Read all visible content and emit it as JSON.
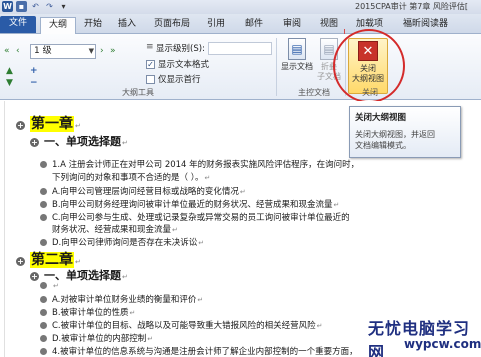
{
  "window": {
    "title": "2015CPA审计 第7章 风险评估["
  },
  "qat": {
    "word": "W",
    "save": "▪",
    "undo": "↶",
    "redo": "↷",
    "more": "▾"
  },
  "tabs": {
    "file": "文件",
    "outline": "大纲",
    "home": "开始",
    "insert": "插入",
    "layout": "页面布局",
    "references": "引用",
    "mailings": "邮件",
    "review": "审阅",
    "view": "视图",
    "addins": "加载项",
    "foxit": "福昕阅读器"
  },
  "ribbon": {
    "level_value": "1 级",
    "show_level_label": "显示级别(S):",
    "show_text_format": "显示文本格式",
    "first_line_only": "仅显示首行",
    "group_outline_tools": "大纲工具",
    "show_document": "显示文档",
    "collapse": "折叠",
    "subdocument": "子文档",
    "group_master_doc": "主控文档",
    "close_outline_line1": "关闭",
    "close_outline_line2": "大纲视图",
    "group_close": "关闭"
  },
  "tooltip": {
    "title": "关闭大纲视图",
    "desc": "关闭大纲视图，并返回\n文档编辑模式。"
  },
  "document": {
    "ch1": "第一章",
    "ch1_sec": "一、单项选择题",
    "q1_line1": "1.A 注册会计师正在对甲公司 2014 年的财务报表实施风险评估程序，在询问时，",
    "q1_line2": "下列询问的对象和事项不合适的是（    ）。",
    "q1_a": "A.向甲公司管理层询问经营目标或战略的变化情况",
    "q1_b": "B.向甲公司财务经理询问被审计单位最近的财务状况、经营成果和现金流量",
    "q1_c1": "C.向甲公司参与生成、处理或记录复杂或异常交易的员工询问被审计单位最近的",
    "q1_c2": "财务状况、经营成果和现金流量",
    "q1_d": "D.向甲公司律师询问是否存在未决诉讼",
    "ch2": "第二章",
    "ch2_sec": "一、单项选择题",
    "q2_a": "A.对被审计单位财务业绩的衡量和评价",
    "q2_b": "B.被审计单位的性质",
    "q2_c": "C.被审计单位的目标、战略以及可能导致重大错报风险的相关经营风险",
    "q2_d": "D.被审计单位的内部控制",
    "q2_4": "4.被审计单位的信息系统与沟通是注册会计师了解企业内部控制的一个重要方面，"
  },
  "watermark": {
    "line1": "无忧电脑学习网",
    "line2": "wypcw.com"
  }
}
